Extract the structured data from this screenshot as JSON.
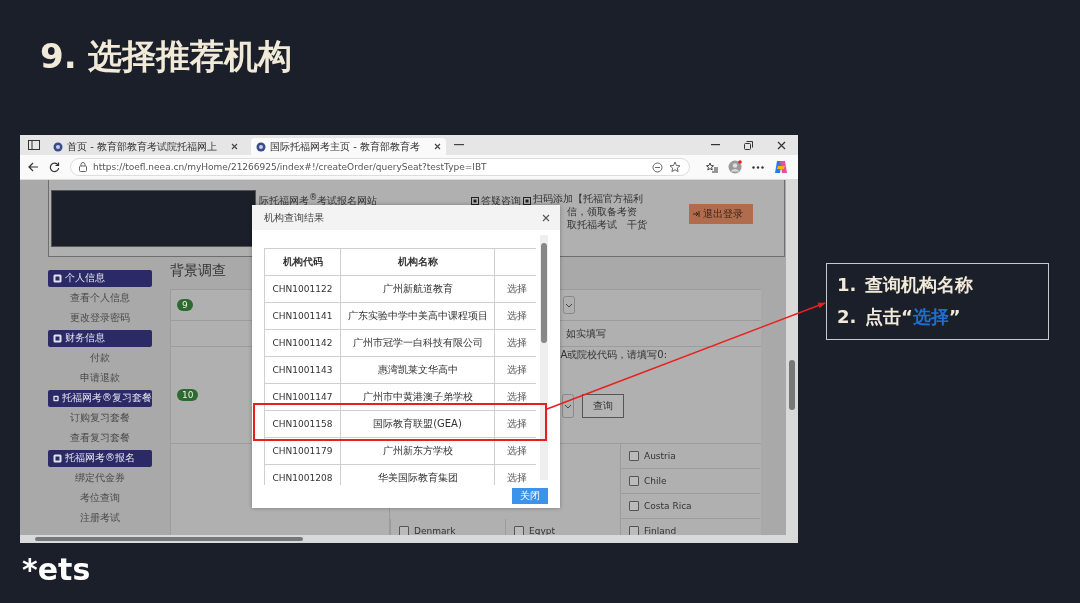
{
  "slide_title": "9. 选择推荐机构",
  "browser": {
    "tabs": [
      {
        "title": "首页 - 教育部教育考试院托福网上",
        "selected": false
      },
      {
        "title": "国际托福网考主页 - 教育部教育考",
        "selected": true
      }
    ],
    "url": "https://toefl.neea.cn/myHome/21266925/index#!/createOrder/querySeat?testType=IBT"
  },
  "page": {
    "site_title": "际托福网考$^{®}$考试报名网站",
    "qr_label": "答疑咨询",
    "promo_lines": [
      "扫码添加【托福官方福利",
      "信，领取备考资",
      "取托福考试　干货"
    ],
    "logout_button": "退出登录",
    "sidebar": [
      {
        "kind": "header",
        "label": "个人信息"
      },
      {
        "kind": "link",
        "label": "查看个人信息"
      },
      {
        "kind": "link",
        "label": "更改登录密码"
      },
      {
        "kind": "header",
        "label": "财务信息"
      },
      {
        "kind": "link",
        "label": "付款"
      },
      {
        "kind": "link",
        "label": "申请退款"
      },
      {
        "kind": "header",
        "label": "托福网考®复习套餐"
      },
      {
        "kind": "link",
        "label": "订购复习套餐"
      },
      {
        "kind": "link",
        "label": "查看复习套餐"
      },
      {
        "kind": "header",
        "label": "托福网考®报名"
      },
      {
        "kind": "link",
        "label": "绑定代金券"
      },
      {
        "kind": "link",
        "label": "考位查询"
      },
      {
        "kind": "link",
        "label": "注册考试"
      }
    ],
    "section_title": "背景调查",
    "badges": [
      "9",
      "10"
    ],
    "form_texts": [
      "如实填写",
      "A或院校代码，请填写0:"
    ],
    "query_button": "查询",
    "countries": [
      {
        "name": "Austria",
        "checked": false
      },
      {
        "name": "Chile",
        "checked": false
      },
      {
        "name": "Costa Rica",
        "checked": false
      },
      {
        "name": "Denmark",
        "checked": false
      },
      {
        "name": "Egypt",
        "checked": false
      },
      {
        "name": "Finland",
        "checked": false
      }
    ]
  },
  "dialog": {
    "title": "机构查询结果",
    "columns": [
      "机构代码",
      "机构名称"
    ],
    "rows": [
      {
        "code": "CHN1001122",
        "name": "广州新航道教育",
        "action": "选择"
      },
      {
        "code": "CHN1001141",
        "name": "广东实验中学中美高中课程项目",
        "action": "选择"
      },
      {
        "code": "CHN1001142",
        "name": "广州市冠学一白科技有限公司",
        "action": "选择"
      },
      {
        "code": "CHN1001143",
        "name": "惠湾凯莱文华高中",
        "action": "选择"
      },
      {
        "code": "CHN1001147",
        "name": "广州市中黄港澳子弟学校",
        "action": "选择"
      },
      {
        "code": "CHN1001158",
        "name": "国际教育联盟(GEA)",
        "action": "选择"
      },
      {
        "code": "CHN1001179",
        "name": "广州新东方学校",
        "action": "选择"
      },
      {
        "code": "CHN1001208",
        "name": "华美国际教育集团",
        "action": "选择"
      }
    ],
    "close_button": "关闭"
  },
  "callout": {
    "steps": [
      {
        "number": "1.",
        "before": "查询机构名称"
      },
      {
        "number": "2.",
        "before": "点击“",
        "highlight": "选择",
        "after": "”"
      }
    ]
  },
  "logo": "*ets"
}
